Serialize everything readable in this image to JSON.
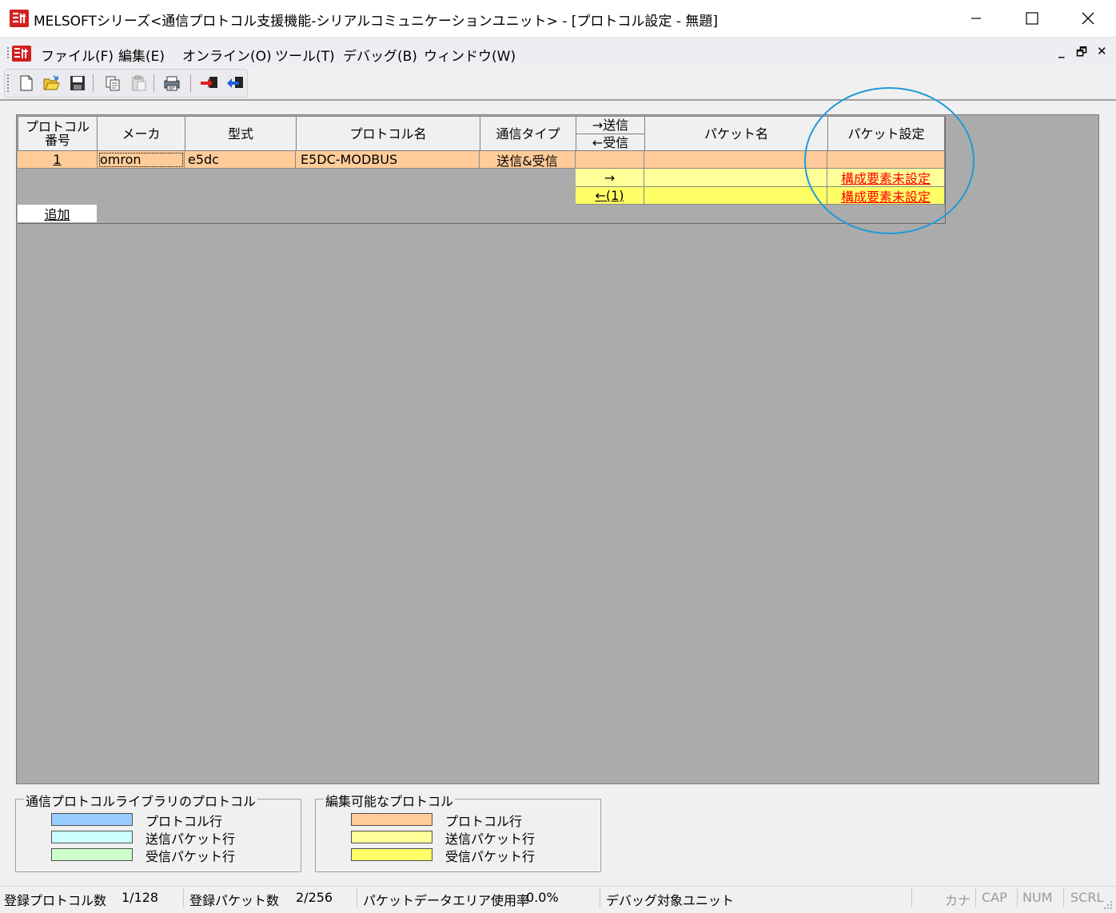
{
  "window": {
    "title": "MELSOFTシリーズ<通信プロトコル支援機能-シリアルコミュニケーションユニット> - [プロトコル設定 - 無題]"
  },
  "menu": {
    "items": [
      "ファイル(F)",
      "編集(E)",
      "オンライン(O)",
      "ツール(T)",
      "デバッグ(B)",
      "ウィンドウ(W)"
    ],
    "mdi_controls": [
      "_",
      "🗗",
      "✕"
    ]
  },
  "toolbar": {
    "icons": [
      "new-icon",
      "open-icon",
      "save-icon",
      "copy-icon",
      "paste-icon",
      "print-icon",
      "write-icon",
      "read-icon"
    ]
  },
  "grid": {
    "headers": {
      "protocol_no": "プロトコル\n番号",
      "maker": "メーカ",
      "model": "型式",
      "protocol_name": "プロトコル名",
      "comm_type": "通信タイプ",
      "direction_send": "→送信",
      "direction_recv": "←受信",
      "packet_name": "パケット名",
      "packet_setting": "パケット設定"
    },
    "protocol_row": {
      "no": "1",
      "maker": "omron",
      "model": "e5dc",
      "name": "E5DC-MODBUS",
      "type": "送信&受信"
    },
    "packet_rows": [
      {
        "direction": "→",
        "name": "",
        "setting": "構成要素未設定"
      },
      {
        "direction": "←(1)",
        "name": "",
        "setting": "構成要素未設定"
      }
    ],
    "add_label": "追加"
  },
  "legend": {
    "library": {
      "title": "通信プロトコルライブラリのプロトコル",
      "items": [
        {
          "label": "プロトコル行",
          "color": "#99ccff"
        },
        {
          "label": "送信パケット行",
          "color": "#ccffff"
        },
        {
          "label": "受信パケット行",
          "color": "#ccffcc"
        }
      ]
    },
    "editable": {
      "title": "編集可能なプロトコル",
      "items": [
        {
          "label": "プロトコル行",
          "color": "#ffcc99"
        },
        {
          "label": "送信パケット行",
          "color": "#ffff99"
        },
        {
          "label": "受信パケット行",
          "color": "#ffff66"
        }
      ]
    }
  },
  "status": {
    "protocol_count_label": "登録プロトコル数",
    "protocol_count": "1/128",
    "packet_count_label": "登録パケット数",
    "packet_count": "2/256",
    "area_usage_label": "パケットデータエリア使用率",
    "area_usage": "0.0%",
    "debug_target": "デバッグ対象ユニット",
    "indicators": [
      "カナ",
      "CAP",
      "NUM",
      "SCRL"
    ]
  },
  "colors": {
    "protocol_row": "#ffcc99",
    "send_packet_row": "#ffff99",
    "recv_packet_row": "#ffff66",
    "grid_background": "#ababab",
    "annotation_circle": "#1f9ad6",
    "unset_link": "#ff0000"
  }
}
